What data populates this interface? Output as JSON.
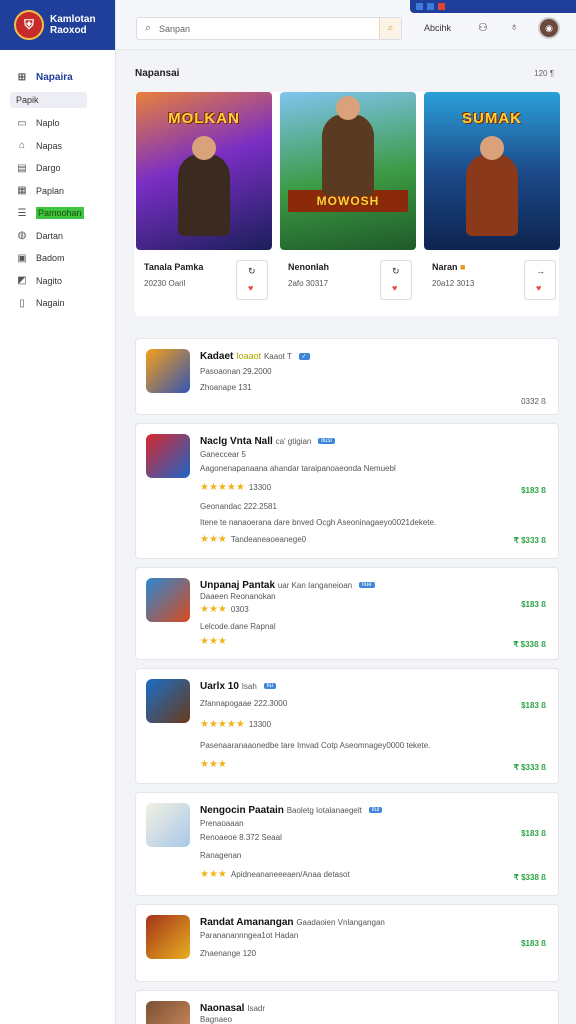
{
  "brand": {
    "line1": "Kamlotan",
    "line2": "Raoxod"
  },
  "sidebar": {
    "items": [
      {
        "label": "Napaira",
        "icon": "grid-icon"
      },
      {
        "label": "Papik",
        "icon": "none"
      },
      {
        "label": "Naplo",
        "icon": "book-icon"
      },
      {
        "label": "Napas",
        "icon": "home-icon"
      },
      {
        "label": "Dargo",
        "icon": "calendar-icon"
      },
      {
        "label": "Paplan",
        "icon": "chart-icon"
      },
      {
        "label": "Pamoohan",
        "icon": "list-icon"
      },
      {
        "label": "Dartan",
        "icon": "globe-icon"
      },
      {
        "label": "Badom",
        "icon": "calendar-icon"
      },
      {
        "label": "Nagito",
        "icon": "image-icon"
      },
      {
        "label": "Nagain",
        "icon": "doc-icon"
      }
    ]
  },
  "topbar": {
    "search_placeholder": "Sanpan",
    "action_label": "Abcihk"
  },
  "section": {
    "title": "Napansai",
    "count": "120 ¶"
  },
  "featured": [
    {
      "title_art": "MOLKAN",
      "name": "Tanala Pamka",
      "sub": "20230 Oaril",
      "colors": [
        "#2e2a8a",
        "#e88a30"
      ]
    },
    {
      "title_art": "MOWOSH",
      "name": "Nenonlah",
      "sub": "2afo 30317",
      "colors": [
        "#2f8a3a",
        "#6fb7e8"
      ]
    },
    {
      "title_art": "SUMAK",
      "name": "Naran",
      "sub": "20a12 3013",
      "colors": [
        "#17407a",
        "#2a9ad0"
      ]
    }
  ],
  "list": [
    {
      "title": "Kadaet",
      "extra": "Ioaaot",
      "suffix": "Kaaot T",
      "lines": [
        "Pasoaonan 29.2000",
        "Zhoanape 131"
      ],
      "right_top": "",
      "right_bottom": "0332 ß",
      "icon_colors": [
        "#f4a019",
        "#3454b4"
      ]
    },
    {
      "title": "Naclg Vnta Nall",
      "extra": "ca' gtigian",
      "tag": "Ilusl",
      "lines": [
        "Ganeccear 5",
        "Aagonenapanaana ahandar taraipanoaeonda Nemuebl"
      ],
      "rating": "13300",
      "meta": "Geonandac 222.2581",
      "desc": "Itene te nanaoerana dare bnved Ocgh Aseoninagaeyo0021dekete.",
      "rating2": "Tandeaneaoeanege0",
      "price1": "$183 ß",
      "price2": "₹ $333 ß",
      "icon_colors": [
        "#d7272e",
        "#1d66c8"
      ]
    },
    {
      "title": "Unpanaj Pantak",
      "extra": "uar Kan Ianganeioan",
      "tag": "Ilue",
      "lines": [
        "Daaeen Reonanokan",
        "Lelcode.dane Rapnal"
      ],
      "rating": "0303",
      "price1": "$183 ß",
      "price2": "₹ $33ß ß",
      "icon_colors": [
        "#2a88d4",
        "#d84a1c"
      ]
    },
    {
      "title": "Uarlx 10",
      "extra": "Isah",
      "tag": "Ilu",
      "lines": [
        "Zfannapogaae 222.3000",
        "Pasenaaranaaonedbe tare Imvad Cotp Aseomnagey0000 tekete."
      ],
      "rating": "13300",
      "price1": "$183 ß",
      "price2": "₹ $333 ß",
      "icon_colors": [
        "#1a6ec8",
        "#6a3a1a"
      ]
    },
    {
      "title": "Nengocin Paatain",
      "extra": "Baoletg Iotalanaegelt",
      "tag": "Ilul",
      "lines": [
        "Prenaoaaan",
        "Renoaeoe 8.372 Seaal",
        "Ranagenan",
        "Apidneananeeeaen/Anaa detasot"
      ],
      "price1": "$183 ß",
      "price2": "₹ $338 ß",
      "icon_colors": [
        "#e8e6d6",
        "#3a7cc8"
      ]
    },
    {
      "title": "Randat Amanangan",
      "extra": "Gaadaoien Vnlangangan",
      "tag": "",
      "lines": [
        "Parananannngea1ot Hadan",
        "Zhaenange 120"
      ],
      "price1": "$183 ß",
      "icon_colors": [
        "#a4321a",
        "#e8b020"
      ]
    },
    {
      "title": "Naonasal",
      "extra": "Isadr",
      "tag": "",
      "lines": [
        "Bagnaeo"
      ],
      "icon_colors": [
        "#7a5034",
        "#d69060"
      ]
    }
  ]
}
